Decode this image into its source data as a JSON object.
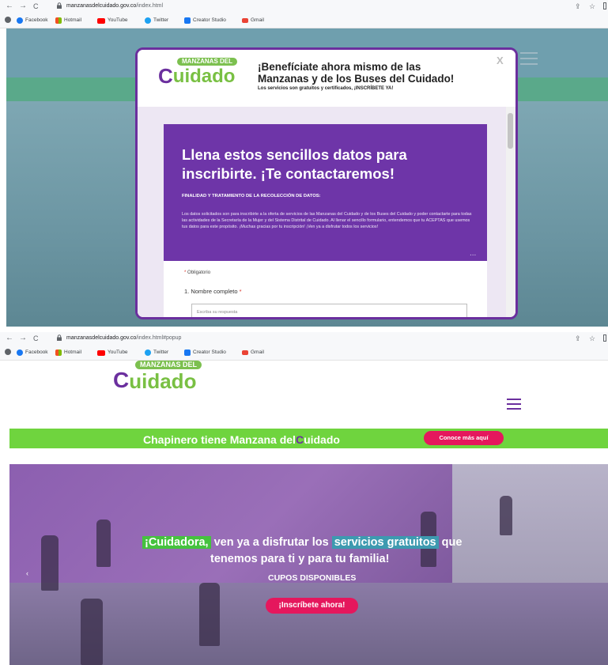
{
  "browser": {
    "nav": {
      "back": "←",
      "forward": "→",
      "reload": "C"
    },
    "url_host_1": "manzanasdelcuidado.gov.co",
    "url_path_1": "/index.html",
    "url_host_2": "manzanasdelcuidado.gov.co",
    "url_path_2": "/index.html#popup",
    "right_icons": {
      "share": "⇪",
      "star": "☆"
    },
    "bookmarks": [
      {
        "label": "Facebook",
        "icon": "facebook-icon",
        "color": "#1877f2"
      },
      {
        "label": "Hotmail",
        "icon": "hotmail-icon",
        "color": "#f25022"
      },
      {
        "label": "YouTube",
        "icon": "youtube-icon",
        "color": "#ff0000"
      },
      {
        "label": "Twitter",
        "icon": "twitter-icon",
        "color": "#1da1f2"
      },
      {
        "label": "Creator Studio",
        "icon": "creator-studio-icon",
        "color": "#1877f2"
      },
      {
        "label": "Gmail",
        "icon": "gmail-icon",
        "color": "#ea4335"
      }
    ]
  },
  "logo": {
    "top": "MANZANAS DEL",
    "bottom": "uidado"
  },
  "modal": {
    "title": "¡Benefíciate ahora mismo de las Manzanas y de los Buses del Cuidado!",
    "subtitle": "Los servicios son gratuitos y certificados, ¡INSCRÍBETE YA!",
    "close": "X"
  },
  "form": {
    "heading": "Llena estos sencillos datos para inscribirte. ¡Te contactaremos!",
    "section_title": "FINALIDAD Y TRATAMIENTO DE LA RECOLECCIÓN DE DATOS:",
    "section_text": "Los datos solicitados son para inscribirte a la oferta de servicios de las Manzanas del Cuidado y de los Buses del Cuidado y poder contactarte para todas las actividades de la Secretaría de la Mujer y del Sistema Distrital de Cuidado. Al llenar el sencillo formulario, entendemos que tu ACEPTAS que usemos tus datos para este propósito. ¡Muchas gracias por tu inscripción! ¡Ven ya a disfrutar todos los servicios!",
    "more": "...",
    "required_note": "Obligatorio",
    "question_1": "1. Nombre completo",
    "answer_placeholder": "Escriba su respuesta",
    "star": "*"
  },
  "promo": {
    "text_a": "Chapinero tiene",
    "text_b": "Manzana del",
    "text_c": "uidado",
    "button": "Conoce más aquí"
  },
  "hero": {
    "highlight_1": "¡Cuidadora,",
    "text_1": "ven ya a disfrutar los",
    "highlight_2": "servicios gratuitos",
    "text_2": "que",
    "line_2": "tenemos para ti y para tu familia!",
    "cupos": "CUPOS DISPONIBLES",
    "button": "¡Inscríbete ahora!",
    "arrow": "‹"
  },
  "colors": {
    "brand_purple": "#6b2f9e",
    "brand_green": "#79c043",
    "promo_green": "#6fd43e",
    "cta_pink": "#e5175d"
  }
}
